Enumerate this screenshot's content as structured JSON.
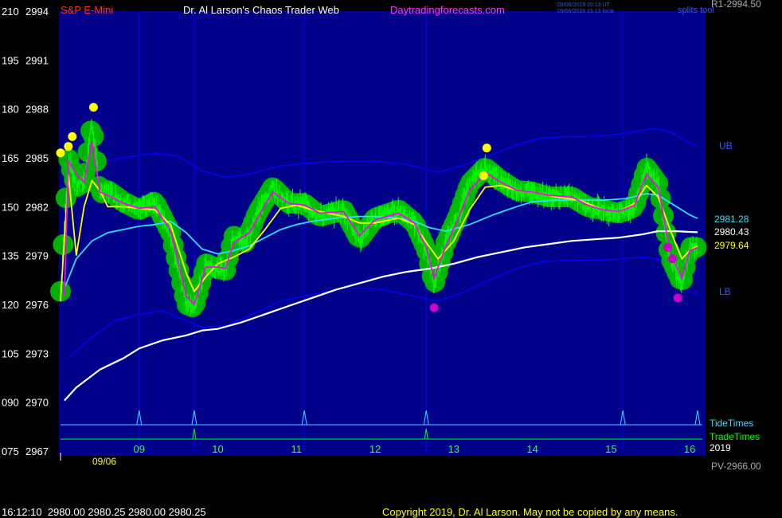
{
  "header": {
    "instrument": "S&P E-Mini",
    "title": "Dr. Al Larson's Chaos Trader Web",
    "site": "Daytradingforecasts.com",
    "timestamp_ut": "09/06/2019 20:13 UT",
    "timestamp_local": "09/06/2019 15:13 local",
    "splits_label": "splits tool",
    "r1_label": "R1-2994.50"
  },
  "footer": {
    "quote": "16:12:10  2980.00 2980.25 2980.00 2980.25",
    "copyright": "Copyright 2019, Dr. Al Larson. May not be copied by any means.",
    "pv_label": "PV-2966.00"
  },
  "colors": {
    "background": "#000000",
    "plot_background": "#00008b",
    "grid": "#0000ff",
    "price_bars": "#00ff00",
    "hilite": "#00bb00",
    "yellow_ma": "#ffff00",
    "magenta_ma": "#ff00ff",
    "cyan_ma": "#33ddff",
    "white_ma": "#ffffff",
    "band": "#0000ff",
    "instrument_label": "#ff3030",
    "site_label": "#ff33ff"
  },
  "chart_data": {
    "type": "line",
    "ylim": [
      2967,
      2994
    ],
    "y_ticks": [
      {
        "left": "210",
        "price": "2994"
      },
      {
        "left": "195",
        "price": "2991"
      },
      {
        "left": "180",
        "price": "2988"
      },
      {
        "left": "165",
        "price": "2985"
      },
      {
        "left": "150",
        "price": "2982"
      },
      {
        "left": "135",
        "price": "2979"
      },
      {
        "left": "120",
        "price": "2976"
      },
      {
        "left": "105",
        "price": "2973"
      },
      {
        "left": "090",
        "price": "2970"
      },
      {
        "left": "075",
        "price": "2967"
      }
    ],
    "x_range": [
      8.0,
      16.1
    ],
    "x_ticks": [
      "09",
      "10",
      "11",
      "12",
      "13",
      "14",
      "15",
      "16"
    ],
    "date_label": "09/06",
    "year_label": "2019",
    "band_labels": {
      "upper": "UB",
      "lower": "LB"
    },
    "value_labels": [
      {
        "value": "2981.28",
        "series": "cyan"
      },
      {
        "value": "2980.43",
        "series": "white"
      },
      {
        "value": "2979.64",
        "series": "yellow"
      }
    ],
    "tide_times": {
      "label": "TideTimes",
      "x": [
        9.0,
        9.7,
        11.1,
        12.65,
        15.15,
        16.1
      ]
    },
    "trade_times": {
      "label": "TradeTimes",
      "x": [
        9.7,
        12.65
      ]
    },
    "price_series": [
      [
        8.0,
        2976.8
      ],
      [
        8.1,
        2985.0
      ],
      [
        8.2,
        2983.2
      ],
      [
        8.3,
        2983.5
      ],
      [
        8.4,
        2987.2
      ],
      [
        8.5,
        2982.8
      ],
      [
        8.6,
        2983.0
      ],
      [
        8.8,
        2982.3
      ],
      [
        9.0,
        2981.8
      ],
      [
        9.2,
        2982.3
      ],
      [
        9.4,
        2980.4
      ],
      [
        9.6,
        2976.0
      ],
      [
        9.7,
        2975.8
      ],
      [
        9.85,
        2978.5
      ],
      [
        10.0,
        2978.2
      ],
      [
        10.1,
        2978.1
      ],
      [
        10.2,
        2980.2
      ],
      [
        10.35,
        2979.8
      ],
      [
        10.5,
        2981.6
      ],
      [
        10.7,
        2983.2
      ],
      [
        10.9,
        2982.2
      ],
      [
        11.1,
        2982.2
      ],
      [
        11.3,
        2981.4
      ],
      [
        11.6,
        2981.8
      ],
      [
        11.8,
        2980.0
      ],
      [
        12.0,
        2981.3
      ],
      [
        12.3,
        2981.8
      ],
      [
        12.5,
        2981.0
      ],
      [
        12.65,
        2979.4
      ],
      [
        12.75,
        2977.2
      ],
      [
        12.9,
        2979.8
      ],
      [
        13.05,
        2981.4
      ],
      [
        13.2,
        2983.4
      ],
      [
        13.4,
        2984.4
      ],
      [
        13.6,
        2983.6
      ],
      [
        13.8,
        2983.0
      ],
      [
        14.0,
        2982.9
      ],
      [
        14.2,
        2982.6
      ],
      [
        14.5,
        2982.6
      ],
      [
        14.7,
        2982.0
      ],
      [
        14.9,
        2981.8
      ],
      [
        15.1,
        2981.6
      ],
      [
        15.3,
        2982.0
      ],
      [
        15.45,
        2984.4
      ],
      [
        15.6,
        2983.4
      ],
      [
        15.75,
        2978.9
      ],
      [
        15.9,
        2977.3
      ],
      [
        16.0,
        2979.5
      ],
      [
        16.1,
        2979.5
      ]
    ],
    "series": [
      {
        "key": "yellow",
        "values": [
          [
            8.0,
            2976.2
          ],
          [
            8.1,
            2984.0
          ],
          [
            8.2,
            2979.0
          ],
          [
            8.3,
            2982.0
          ],
          [
            8.4,
            2983.6
          ],
          [
            8.5,
            2983.0
          ],
          [
            8.6,
            2982.0
          ],
          [
            8.8,
            2982.0
          ],
          [
            9.0,
            2981.9
          ],
          [
            9.2,
            2981.8
          ],
          [
            9.4,
            2980.9
          ],
          [
            9.6,
            2977.9
          ],
          [
            9.7,
            2976.8
          ],
          [
            9.85,
            2977.7
          ],
          [
            10.0,
            2978.5
          ],
          [
            10.2,
            2978.9
          ],
          [
            10.4,
            2979.4
          ],
          [
            10.6,
            2980.6
          ],
          [
            10.8,
            2981.9
          ],
          [
            11.0,
            2982.1
          ],
          [
            11.2,
            2981.8
          ],
          [
            11.4,
            2981.6
          ],
          [
            11.6,
            2981.4
          ],
          [
            11.8,
            2981.0
          ],
          [
            12.0,
            2981.0
          ],
          [
            12.3,
            2981.3
          ],
          [
            12.5,
            2980.9
          ],
          [
            12.65,
            2979.8
          ],
          [
            12.8,
            2978.8
          ],
          [
            13.0,
            2979.9
          ],
          [
            13.2,
            2981.8
          ],
          [
            13.4,
            2983.2
          ],
          [
            13.6,
            2983.3
          ],
          [
            13.8,
            2983.0
          ],
          [
            14.0,
            2982.9
          ],
          [
            14.3,
            2982.6
          ],
          [
            14.6,
            2982.4
          ],
          [
            14.9,
            2981.8
          ],
          [
            15.1,
            2981.7
          ],
          [
            15.3,
            2982.2
          ],
          [
            15.45,
            2983.3
          ],
          [
            15.6,
            2982.6
          ],
          [
            15.75,
            2980.6
          ],
          [
            15.9,
            2978.8
          ],
          [
            16.0,
            2979.3
          ],
          [
            16.1,
            2979.6
          ]
        ]
      },
      {
        "key": "magenta",
        "values": [
          [
            8.05,
            2976.5
          ],
          [
            8.1,
            2984.8
          ],
          [
            8.2,
            2984.0
          ],
          [
            8.3,
            2983.5
          ],
          [
            8.4,
            2986.0
          ],
          [
            8.5,
            2982.9
          ],
          [
            8.6,
            2982.7
          ],
          [
            8.8,
            2982.2
          ],
          [
            9.0,
            2981.9
          ],
          [
            9.2,
            2982.0
          ],
          [
            9.4,
            2980.5
          ],
          [
            9.6,
            2976.5
          ],
          [
            9.7,
            2976.0
          ],
          [
            9.85,
            2978.3
          ],
          [
            10.0,
            2978.3
          ],
          [
            10.1,
            2978.2
          ],
          [
            10.2,
            2979.8
          ],
          [
            10.4,
            2980.4
          ],
          [
            10.6,
            2982.1
          ],
          [
            10.7,
            2982.9
          ],
          [
            10.9,
            2982.2
          ],
          [
            11.1,
            2982.1
          ],
          [
            11.3,
            2981.6
          ],
          [
            11.6,
            2981.7
          ],
          [
            11.8,
            2980.2
          ],
          [
            12.0,
            2981.2
          ],
          [
            12.3,
            2981.6
          ],
          [
            12.5,
            2981.0
          ],
          [
            12.65,
            2979.5
          ],
          [
            12.75,
            2977.6
          ],
          [
            12.9,
            2979.6
          ],
          [
            13.05,
            2981.2
          ],
          [
            13.2,
            2983.0
          ],
          [
            13.4,
            2984.1
          ],
          [
            13.6,
            2983.5
          ],
          [
            13.8,
            2983.0
          ],
          [
            14.0,
            2982.9
          ],
          [
            14.2,
            2982.7
          ],
          [
            14.5,
            2982.6
          ],
          [
            14.7,
            2982.1
          ],
          [
            14.9,
            2981.8
          ],
          [
            15.1,
            2981.7
          ],
          [
            15.3,
            2982.1
          ],
          [
            15.45,
            2984.0
          ],
          [
            15.6,
            2983.2
          ],
          [
            15.75,
            2979.2
          ],
          [
            15.9,
            2977.6
          ],
          [
            16.0,
            2979.3
          ],
          [
            16.1,
            2979.5
          ]
        ]
      },
      {
        "key": "cyan",
        "values": [
          [
            8.05,
            2977.0
          ],
          [
            8.2,
            2978.8
          ],
          [
            8.4,
            2979.9
          ],
          [
            8.6,
            2980.4
          ],
          [
            8.8,
            2980.6
          ],
          [
            9.0,
            2980.8
          ],
          [
            9.2,
            2980.9
          ],
          [
            9.4,
            2981.1
          ],
          [
            9.6,
            2980.4
          ],
          [
            9.8,
            2979.4
          ],
          [
            10.0,
            2979.1
          ],
          [
            10.2,
            2979.3
          ],
          [
            10.4,
            2979.6
          ],
          [
            10.6,
            2980.1
          ],
          [
            10.8,
            2980.6
          ],
          [
            11.0,
            2980.9
          ],
          [
            11.2,
            2981.1
          ],
          [
            11.5,
            2981.3
          ],
          [
            11.8,
            2981.4
          ],
          [
            12.0,
            2981.4
          ],
          [
            12.3,
            2981.3
          ],
          [
            12.5,
            2981.1
          ],
          [
            12.7,
            2980.7
          ],
          [
            12.9,
            2980.5
          ],
          [
            13.2,
            2980.9
          ],
          [
            13.5,
            2981.5
          ],
          [
            13.8,
            2982.0
          ],
          [
            14.0,
            2982.3
          ],
          [
            14.3,
            2982.4
          ],
          [
            14.6,
            2982.4
          ],
          [
            14.9,
            2982.4
          ],
          [
            15.2,
            2982.5
          ],
          [
            15.45,
            2982.8
          ],
          [
            15.6,
            2982.7
          ],
          [
            15.8,
            2982.1
          ],
          [
            16.0,
            2981.5
          ],
          [
            16.1,
            2981.28
          ]
        ]
      },
      {
        "key": "white",
        "values": [
          [
            8.05,
            2970.1
          ],
          [
            8.2,
            2970.9
          ],
          [
            8.5,
            2972.0
          ],
          [
            8.8,
            2972.7
          ],
          [
            9.0,
            2973.3
          ],
          [
            9.3,
            2973.8
          ],
          [
            9.6,
            2974.1
          ],
          [
            9.8,
            2974.4
          ],
          [
            10.0,
            2974.5
          ],
          [
            10.3,
            2974.9
          ],
          [
            10.6,
            2975.4
          ],
          [
            10.9,
            2975.9
          ],
          [
            11.2,
            2976.4
          ],
          [
            11.5,
            2976.9
          ],
          [
            11.8,
            2977.3
          ],
          [
            12.1,
            2977.7
          ],
          [
            12.4,
            2978.0
          ],
          [
            12.7,
            2978.2
          ],
          [
            13.0,
            2978.5
          ],
          [
            13.3,
            2978.9
          ],
          [
            13.6,
            2979.2
          ],
          [
            13.9,
            2979.5
          ],
          [
            14.2,
            2979.7
          ],
          [
            14.5,
            2979.9
          ],
          [
            14.8,
            2980.0
          ],
          [
            15.1,
            2980.1
          ],
          [
            15.4,
            2980.3
          ],
          [
            15.6,
            2980.5
          ],
          [
            15.8,
            2980.5
          ],
          [
            16.0,
            2980.45
          ],
          [
            16.1,
            2980.43
          ]
        ]
      },
      {
        "key": "upper_band",
        "values": [
          [
            8.5,
            2984.7
          ],
          [
            8.8,
            2985.0
          ],
          [
            9.2,
            2985.3
          ],
          [
            9.5,
            2985.1
          ],
          [
            9.8,
            2984.2
          ],
          [
            10.1,
            2983.8
          ],
          [
            10.4,
            2984.0
          ],
          [
            10.8,
            2984.5
          ],
          [
            11.2,
            2984.7
          ],
          [
            11.6,
            2984.8
          ],
          [
            12.0,
            2984.8
          ],
          [
            12.4,
            2984.6
          ],
          [
            12.8,
            2984.1
          ],
          [
            13.1,
            2984.5
          ],
          [
            13.5,
            2985.2
          ],
          [
            13.8,
            2985.8
          ],
          [
            14.1,
            2986.2
          ],
          [
            14.4,
            2986.3
          ],
          [
            14.7,
            2986.3
          ],
          [
            15.0,
            2986.4
          ],
          [
            15.3,
            2986.6
          ],
          [
            15.55,
            2986.8
          ],
          [
            15.75,
            2986.6
          ],
          [
            16.0,
            2985.9
          ],
          [
            16.1,
            2985.7
          ]
        ]
      },
      {
        "key": "lower_band",
        "values": [
          [
            8.1,
            2972.7
          ],
          [
            8.4,
            2974.0
          ],
          [
            8.7,
            2975.0
          ],
          [
            9.0,
            2975.4
          ],
          [
            9.3,
            2975.6
          ],
          [
            9.6,
            2975.0
          ],
          [
            9.8,
            2974.6
          ],
          [
            10.1,
            2974.7
          ],
          [
            10.4,
            2975.3
          ],
          [
            10.8,
            2976.2
          ],
          [
            11.2,
            2976.6
          ],
          [
            11.6,
            2977.0
          ],
          [
            12.0,
            2977.0
          ],
          [
            12.4,
            2976.6
          ],
          [
            12.8,
            2976.2
          ],
          [
            13.1,
            2976.7
          ],
          [
            13.5,
            2977.6
          ],
          [
            13.8,
            2978.2
          ],
          [
            14.1,
            2978.6
          ],
          [
            14.4,
            2978.7
          ],
          [
            14.8,
            2978.7
          ],
          [
            15.1,
            2978.8
          ],
          [
            15.4,
            2978.9
          ],
          [
            15.6,
            2978.8
          ],
          [
            15.8,
            2978.0
          ],
          [
            16.0,
            2976.8
          ],
          [
            16.1,
            2976.6
          ]
        ]
      }
    ],
    "yellow_dots": [
      [
        8.0,
        2985.3
      ],
      [
        8.1,
        2985.7
      ],
      [
        8.15,
        2986.3
      ],
      [
        8.42,
        2988.1
      ],
      [
        13.42,
        2985.6
      ],
      [
        13.38,
        2983.9
      ]
    ],
    "magenta_dots": [
      [
        12.75,
        2975.8
      ],
      [
        15.72,
        2979.5
      ],
      [
        15.78,
        2978.8
      ],
      [
        15.85,
        2976.4
      ]
    ]
  }
}
